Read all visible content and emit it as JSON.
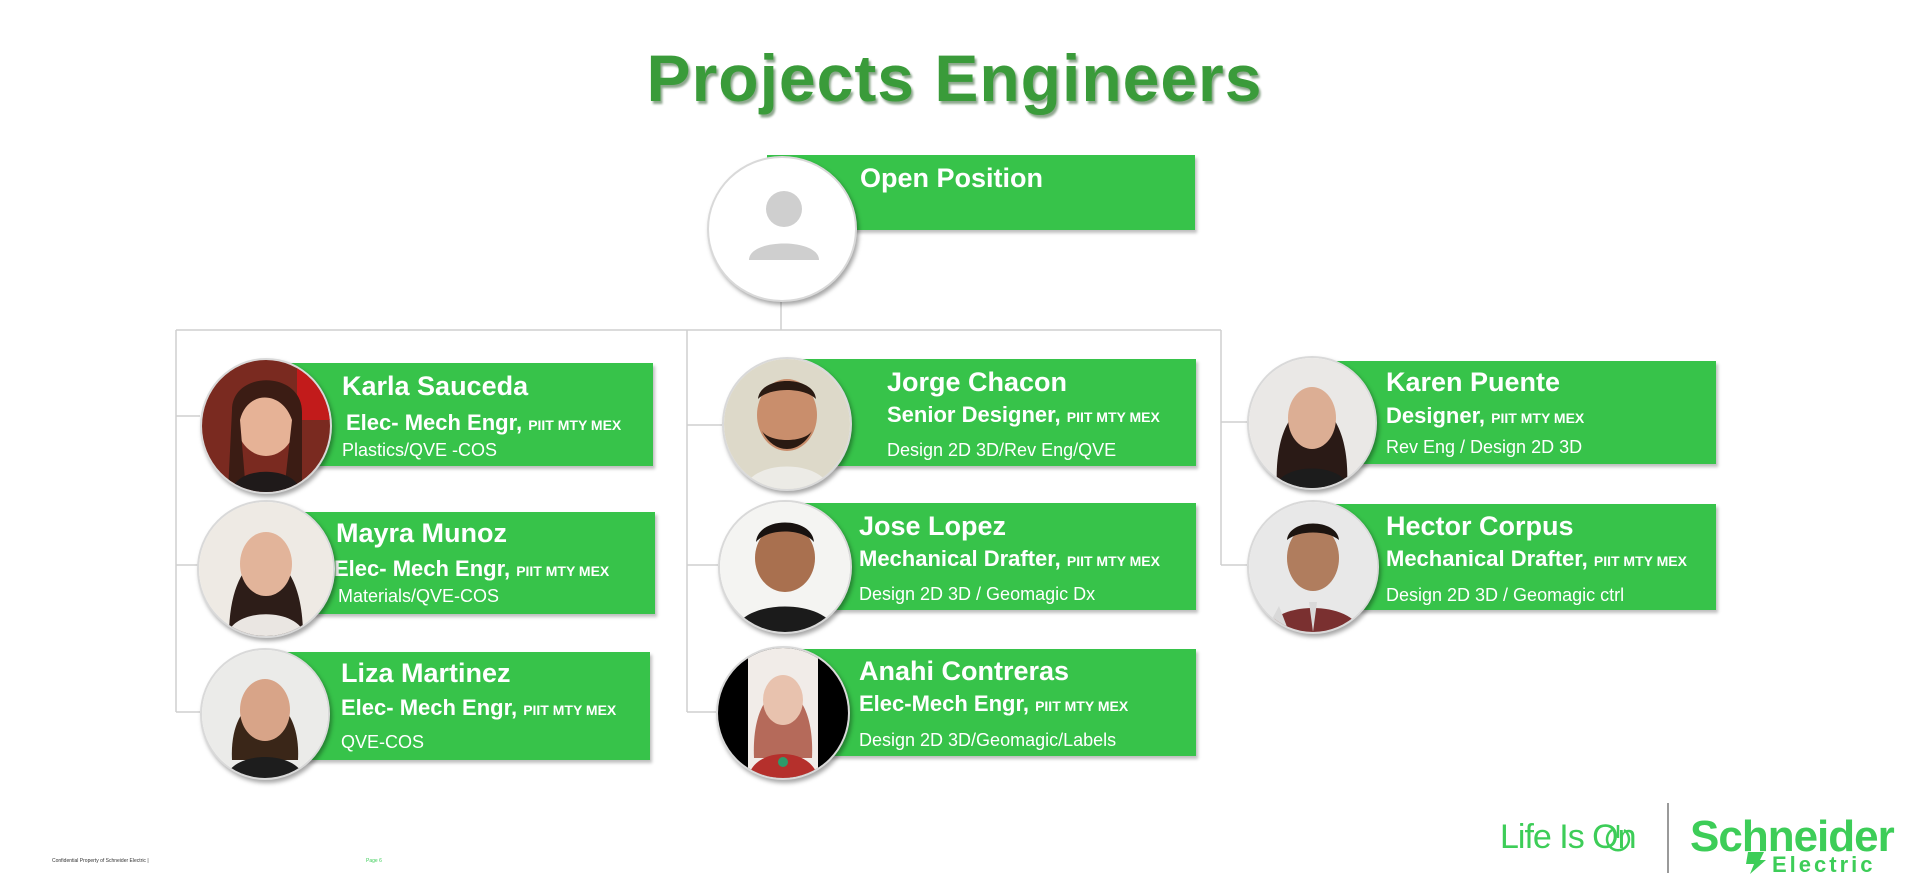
{
  "title": "Projects Engineers",
  "head": {
    "name": "Open Position"
  },
  "members": [
    {
      "name": "Karla Sauceda",
      "role": "Elec- Mech Engr,",
      "location": "PIIT MTY MEX",
      "spec": "Plastics/QVE -COS"
    },
    {
      "name": "Mayra Munoz",
      "role": "Elec- Mech Engr,",
      "location": "PIIT MTY MEX",
      "spec": "Materials/QVE-COS"
    },
    {
      "name": "Liza Martinez",
      "role": "Elec- Mech Engr,",
      "location": "PIIT MTY MEX",
      "spec": "QVE-COS"
    },
    {
      "name": "Jorge Chacon",
      "role": "Senior Designer,",
      "location": "PIIT MTY MEX",
      "spec": "Design 2D 3D/Rev Eng/QVE"
    },
    {
      "name": "Jose Lopez",
      "role": "Mechanical Drafter,",
      "location": "PIIT MTY MEX",
      "spec": "Design 2D 3D / Geomagic Dx"
    },
    {
      "name": "Anahi Contreras",
      "role": "Elec-Mech Engr,",
      "location": "PIIT MTY MEX",
      "spec": "Design 2D 3D/Geomagic/Labels"
    },
    {
      "name": "Karen Puente",
      "role": "Designer,",
      "location": "PIIT MTY MEX",
      "spec": "Rev Eng / Design 2D 3D"
    },
    {
      "name": "Hector Corpus",
      "role": "Mechanical Drafter,",
      "location": "PIIT  MTY MEX",
      "spec": "Design 2D 3D / Geomagic ctrl"
    }
  ],
  "footer": {
    "confidential": "Confidential Property of Schneider Electric |",
    "page": "Page 6",
    "tagline": "Life Is On",
    "brand": "Schneider",
    "brand_sub": "Electric"
  },
  "colors": {
    "card_green": "#37c34a",
    "title_green": "#3a9b3a",
    "brand_green": "#3dcd58"
  },
  "icons": [
    "person-placeholder-icon",
    "power-icon",
    "schneider-logo-icon"
  ]
}
